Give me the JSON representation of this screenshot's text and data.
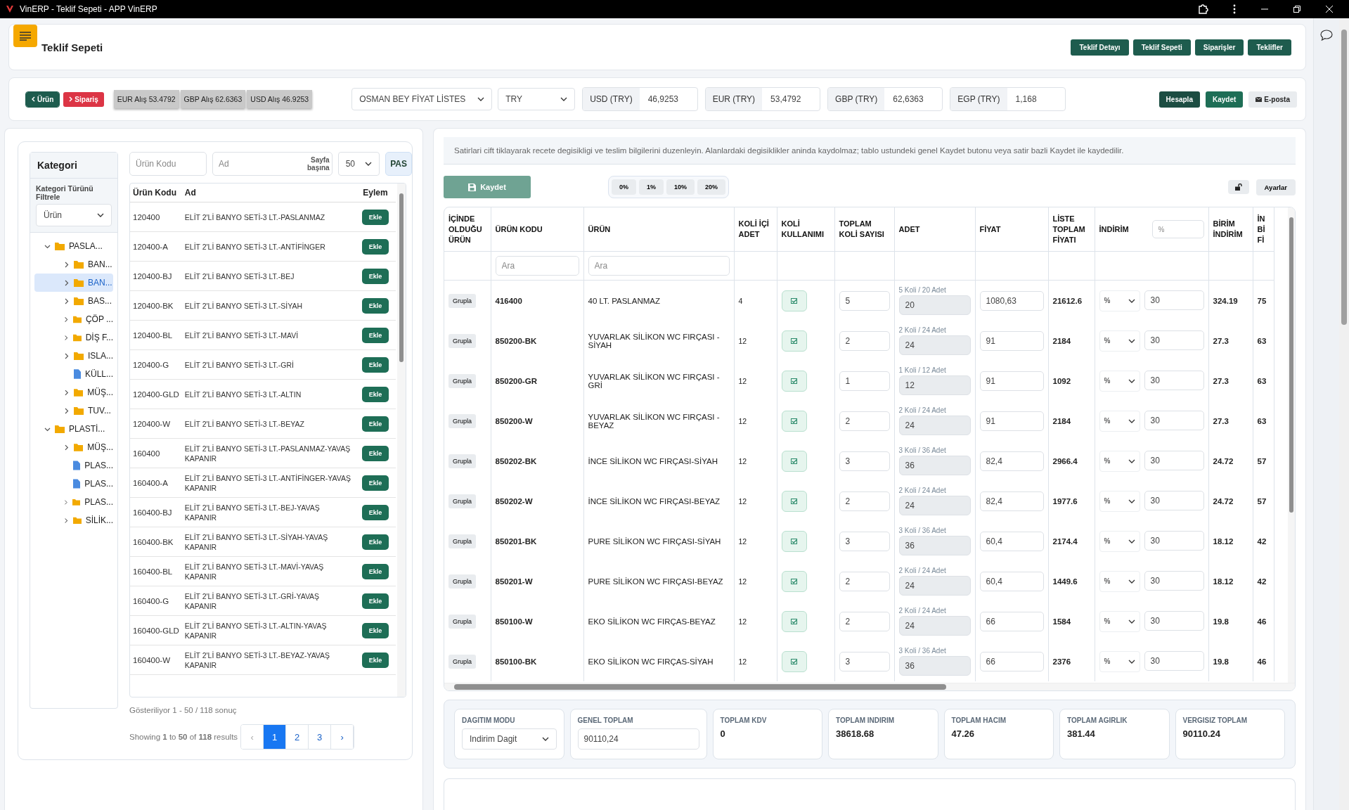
{
  "window": {
    "title": "VinERP - Teklif Sepeti - APP VinERP"
  },
  "header": {
    "title": "Teklif Sepeti",
    "nav_buttons": [
      "Teklif Detayı",
      "Teklif Sepeti",
      "Siparişler",
      "Teklifler"
    ]
  },
  "toolbar": {
    "back_button": "Ürün",
    "forward_button": "Sipariş",
    "rates": [
      "EUR Alış 53.4792",
      "GBP Alış 62.6363",
      "USD Alış 46.9253"
    ],
    "price_list": "OSMAN BEY FİYAT LİSTES",
    "currency": "TRY",
    "rate_fields": [
      {
        "label": "USD (TRY)",
        "value": "46,9253"
      },
      {
        "label": "EUR (TRY)",
        "value": "53,4792"
      },
      {
        "label": "GBP (TRY)",
        "value": "62,6363"
      },
      {
        "label": "EGP (TRY)",
        "value": "1,168"
      }
    ],
    "actions": [
      {
        "kind": "dark",
        "label": "Hesapla"
      },
      {
        "kind": "primary",
        "label": "Kaydet"
      },
      {
        "kind": "mail",
        "label": "E-posta"
      }
    ]
  },
  "category": {
    "title": "Kategori",
    "filter_label": "Kategori Türünü Filtrele",
    "filter_value": "Ürün",
    "tree": [
      {
        "label": "PASLA...",
        "kind": "folder",
        "expanded": true,
        "selected": false,
        "children": [
          {
            "label": "BAN...",
            "kind": "folder",
            "expanded": false,
            "selected": false
          },
          {
            "label": "BAN...",
            "kind": "folder",
            "expanded": false,
            "selected": true
          },
          {
            "label": "BAS...",
            "kind": "folder",
            "expanded": false,
            "selected": false
          },
          {
            "label": "ÇÖP ...",
            "kind": "folder",
            "expanded": false,
            "selected": false
          },
          {
            "label": "DİŞ F...",
            "kind": "folder",
            "expanded": false,
            "selected": false
          },
          {
            "label": "ISLA...",
            "kind": "folder",
            "expanded": false,
            "selected": false
          },
          {
            "label": "KÜLL...",
            "kind": "file",
            "selected": false
          },
          {
            "label": "MÜŞ...",
            "kind": "folder",
            "expanded": false,
            "selected": false
          },
          {
            "label": "TUV...",
            "kind": "folder",
            "expanded": false,
            "selected": false
          }
        ]
      },
      {
        "label": "PLASTİ...",
        "kind": "folder",
        "expanded": true,
        "selected": false,
        "children": [
          {
            "label": "MÜŞ...",
            "kind": "folder",
            "expanded": false,
            "selected": false
          },
          {
            "label": "PLAS...",
            "kind": "file",
            "selected": false
          },
          {
            "label": "PLAS...",
            "kind": "file",
            "selected": false
          },
          {
            "label": "PLAS...",
            "kind": "folder",
            "expanded": false,
            "selected": false
          },
          {
            "label": "SİLİK...",
            "kind": "folder",
            "expanded": false,
            "selected": false
          }
        ]
      }
    ]
  },
  "products": {
    "code_placeholder": "Ürün Kodu",
    "name_placeholder": "Ad",
    "per_page_label": "Sayfa başına",
    "per_page": "50",
    "extra_tab": "PAS",
    "columns": [
      "Ürün Kodu",
      "Ad",
      "Eylem"
    ],
    "rows": [
      {
        "code": "120400",
        "name": "ELİT 2'Lİ BANYO SETİ-3 LT.-PASLANMAZ",
        "action": "Ekle"
      },
      {
        "code": "120400-A",
        "name": "ELİT 2'Lİ BANYO SETİ-3 LT.-ANTİFİNGER",
        "action": "Ekle"
      },
      {
        "code": "120400-BJ",
        "name": "ELİT 2'Lİ BANYO SETİ-3 LT.-BEJ",
        "action": "Ekle"
      },
      {
        "code": "120400-BK",
        "name": "ELİT 2'Lİ BANYO SETİ-3 LT.-SİYAH",
        "action": "Ekle"
      },
      {
        "code": "120400-BL",
        "name": "ELİT 2'Lİ BANYO SETİ-3 LT.-MAVİ",
        "action": "Ekle"
      },
      {
        "code": "120400-G",
        "name": "ELİT 2'Lİ BANYO SETİ-3 LT.-GRİ",
        "action": "Ekle"
      },
      {
        "code": "120400-GLD",
        "name": "ELİT 2'Lİ BANYO SETİ-3 LT.-ALTIN",
        "action": "Ekle"
      },
      {
        "code": "120400-W",
        "name": "ELİT 2'Lİ BANYO SETİ-3 LT.-BEYAZ",
        "action": "Ekle"
      },
      {
        "code": "160400",
        "name": "ELİT 2'Lİ BANYO SETİ-3 LT.-PASLANMAZ-YAVAŞ KAPANIR",
        "action": "Ekle"
      },
      {
        "code": "160400-A",
        "name": "ELİT 2'Lİ BANYO SETİ-3 LT.-ANTİFİNGER-YAVAŞ KAPANIR",
        "action": "Ekle"
      },
      {
        "code": "160400-BJ",
        "name": "ELİT 2'Lİ BANYO SETİ-3 LT.-BEJ-YAVAŞ KAPANIR",
        "action": "Ekle"
      },
      {
        "code": "160400-BK",
        "name": "ELİT 2'Lİ BANYO SETİ-3 LT.-SİYAH-YAVAŞ KAPANIR",
        "action": "Ekle"
      },
      {
        "code": "160400-BL",
        "name": "ELİT 2'Lİ BANYO SETİ-3 LT.-MAVİ-YAVAŞ KAPANIR",
        "action": "Ekle"
      },
      {
        "code": "160400-G",
        "name": "ELİT 2'Lİ BANYO SETİ-3 LT.-GRİ-YAVAŞ KAPANIR",
        "action": "Ekle"
      },
      {
        "code": "160400-GLD",
        "name": "ELİT 2'Lİ BANYO SETİ-3 LT.-ALTIN-YAVAŞ KAPANIR",
        "action": "Ekle"
      },
      {
        "code": "160400-W",
        "name": "ELİT 2'Lİ BANYO SETİ-3 LT.-BEYAZ-YAVAŞ KAPANIR",
        "action": "Ekle"
      }
    ],
    "summary": "Gösteriliyor 1 - 50 / 118 sonuç",
    "results": "Showing **1** to **50** of **118** results",
    "pagination": {
      "prev": "‹",
      "next": "›",
      "pages": [
        {
          "label": "1",
          "selected": true
        },
        {
          "label": "2",
          "selected": false
        },
        {
          "label": "3",
          "selected": false
        }
      ]
    }
  },
  "cart": {
    "info": "Satirlari cift tiklayarak recete degisikligi ve teslim bilgilerini duzenleyin. Alanlardaki degisiklikler aninda kaydolmaz; tablo ustundeki genel Kaydet butonu veya satir bazli Kaydet ile kaydedilir.",
    "save_button": "Kaydet",
    "discounts": [
      "0%",
      "1%",
      "10%",
      "20%"
    ],
    "settings_button": "Ayarlar",
    "columns": [
      "İÇİNDE OLDUĞU ÜRÜN",
      "ÜRÜN KODU",
      "ÜRÜN",
      "KOLİ İÇİ ADET",
      "KOLİ KULLANIMI",
      "TOPLAM KOLİ SAYISI",
      "ADET",
      "FİYAT",
      "LİSTE TOPLAM FİYATI",
      "İNDİRİM",
      "BİRİM İNDİRİM",
      "İN Bİ Fİ"
    ],
    "discount_header_placeholder": "%",
    "code_filter_placeholder": "Ara",
    "product_filter_placeholder": "Ara",
    "rows": [
      {
        "group": "Grupla",
        "code": "416400",
        "product": "40 LT. PASLANMAZ",
        "per_box": "4",
        "use_box": true,
        "boxes": "5",
        "adet_note": "5 Koli / 20 Adet",
        "adet": "20",
        "price": "1080,63",
        "list_total": "21612.6",
        "discount_type": "%",
        "discount": "30",
        "unit_discount": "324.19",
        "column_12": "75"
      },
      {
        "group": "Grupla",
        "code": "850200-BK",
        "product": "YUVARLAK SİLİKON WC FIRÇASI - SİYAH",
        "per_box": "12",
        "use_box": true,
        "boxes": "2",
        "adet_note": "2 Koli / 24 Adet",
        "adet": "24",
        "price": "91",
        "list_total": "2184",
        "discount_type": "%",
        "discount": "30",
        "unit_discount": "27.3",
        "column_12": "63"
      },
      {
        "group": "Grupla",
        "code": "850200-GR",
        "product": "YUVARLAK SİLİKON WC FIRÇASI -GRİ",
        "per_box": "12",
        "use_box": true,
        "boxes": "1",
        "adet_note": "1 Koli / 12 Adet",
        "adet": "12",
        "price": "91",
        "list_total": "1092",
        "discount_type": "%",
        "discount": "30",
        "unit_discount": "27.3",
        "column_12": "63"
      },
      {
        "group": "Grupla",
        "code": "850200-W",
        "product": "YUVARLAK SİLİKON WC FIRÇASI -BEYAZ",
        "per_box": "12",
        "use_box": true,
        "boxes": "2",
        "adet_note": "2 Koli / 24 Adet",
        "adet": "24",
        "price": "91",
        "list_total": "2184",
        "discount_type": "%",
        "discount": "30",
        "unit_discount": "27.3",
        "column_12": "63"
      },
      {
        "group": "Grupla",
        "code": "850202-BK",
        "product": "İNCE SİLİKON WC FIRÇASI-SİYAH",
        "per_box": "12",
        "use_box": true,
        "boxes": "3",
        "adet_note": "3 Koli / 36 Adet",
        "adet": "36",
        "price": "82,4",
        "list_total": "2966.4",
        "discount_type": "%",
        "discount": "30",
        "unit_discount": "24.72",
        "column_12": "57"
      },
      {
        "group": "Grupla",
        "code": "850202-W",
        "product": "İNCE SİLİKON WC FIRÇASI-BEYAZ",
        "per_box": "12",
        "use_box": true,
        "boxes": "2",
        "adet_note": "2 Koli / 24 Adet",
        "adet": "24",
        "price": "82,4",
        "list_total": "1977.6",
        "discount_type": "%",
        "discount": "30",
        "unit_discount": "24.72",
        "column_12": "57"
      },
      {
        "group": "Grupla",
        "code": "850201-BK",
        "product": "PURE SİLİKON WC FIRÇASI-SİYAH",
        "per_box": "12",
        "use_box": true,
        "boxes": "3",
        "adet_note": "3 Koli / 36 Adet",
        "adet": "36",
        "price": "60,4",
        "list_total": "2174.4",
        "discount_type": "%",
        "discount": "30",
        "unit_discount": "18.12",
        "column_12": "42"
      },
      {
        "group": "Grupla",
        "code": "850201-W",
        "product": "PURE SİLİKON WC FIRÇASI-BEYAZ",
        "per_box": "12",
        "use_box": true,
        "boxes": "2",
        "adet_note": "2 Koli / 24 Adet",
        "adet": "24",
        "price": "60,4",
        "list_total": "1449.6",
        "discount_type": "%",
        "discount": "30",
        "unit_discount": "18.12",
        "column_12": "42"
      },
      {
        "group": "Grupla",
        "code": "850100-W",
        "product": "EKO SİLİKON WC FIRÇAS-BEYAZ",
        "per_box": "12",
        "use_box": true,
        "boxes": "2",
        "adet_note": "2 Koli / 24 Adet",
        "adet": "24",
        "price": "66",
        "list_total": "1584",
        "discount_type": "%",
        "discount": "30",
        "unit_discount": "19.8",
        "column_12": "46"
      },
      {
        "group": "Grupla",
        "code": "850100-BK",
        "product": "EKO SİLİKON WC FIRÇAS-SİYAH",
        "per_box": "12",
        "use_box": true,
        "boxes": "3",
        "adet_note": "3 Koli / 36 Adet",
        "adet": "36",
        "price": "66",
        "list_total": "2376",
        "discount_type": "%",
        "discount": "30",
        "unit_discount": "19.8",
        "column_12": "46"
      }
    ],
    "totals": [
      {
        "kind": "select",
        "label": "DAGITIM MODU",
        "value": "Indirim Dagit"
      },
      {
        "kind": "input",
        "label": "GENEL TOPLAM",
        "value": "90110,24"
      },
      {
        "kind": "text",
        "label": "TOPLAM KDV",
        "value": "0"
      },
      {
        "kind": "text",
        "label": "TOPLAM INDIRIM",
        "value": "38618.68"
      },
      {
        "kind": "text",
        "label": "TOPLAM HACIM",
        "value": "47.26"
      },
      {
        "kind": "text",
        "label": "TOPLAM AGIRLIK",
        "value": "381.44"
      },
      {
        "kind": "text",
        "label": "VERGISIZ TOPLAM",
        "value": "90110.24"
      }
    ]
  }
}
